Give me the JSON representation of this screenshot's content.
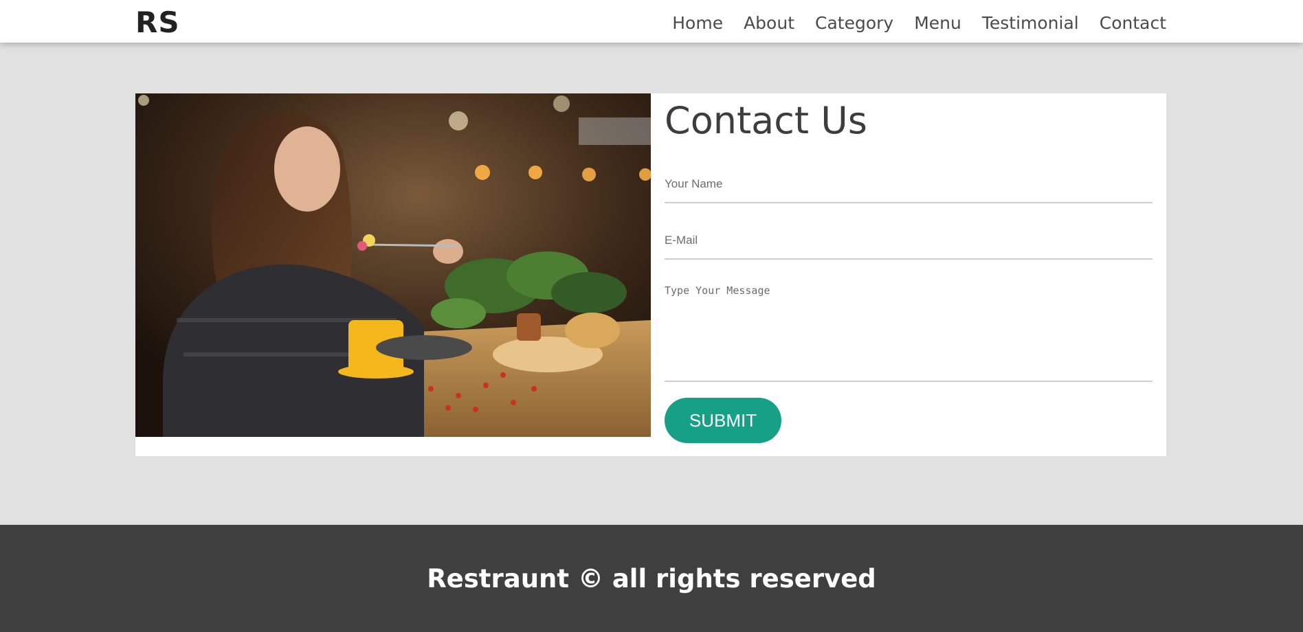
{
  "header": {
    "logo": "RS",
    "nav": [
      {
        "label": "Home"
      },
      {
        "label": "About"
      },
      {
        "label": "Category"
      },
      {
        "label": "Menu"
      },
      {
        "label": "Testimonial"
      },
      {
        "label": "Contact"
      }
    ]
  },
  "contact": {
    "title": "Contact Us",
    "name_placeholder": "Your Name",
    "email_placeholder": "E-Mail",
    "message_placeholder": "Type Your Message",
    "submit_label": "SUBMIT",
    "photo_alt": "woman eating in restaurant"
  },
  "footer": {
    "text": "Restraunt © all rights reserved"
  },
  "colors": {
    "accent": "#16a085",
    "page_bg": "#e1e1e1",
    "footer_bg": "#3f3f3f"
  }
}
